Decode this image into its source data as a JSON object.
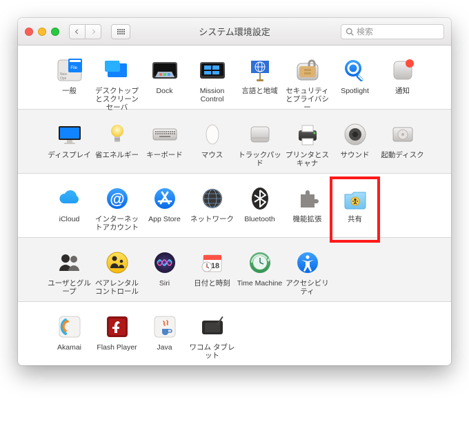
{
  "window": {
    "title": "システム環境設定"
  },
  "search": {
    "placeholder": "検索"
  },
  "highlight": "sharing",
  "sections": [
    {
      "alt": false,
      "items": [
        {
          "id": "general",
          "label": "一般"
        },
        {
          "id": "desktop",
          "label": "デスクトップとスクリーンセーバ"
        },
        {
          "id": "dock",
          "label": "Dock"
        },
        {
          "id": "mission",
          "label": "Mission Control"
        },
        {
          "id": "language",
          "label": "言語と地域"
        },
        {
          "id": "security",
          "label": "セキュリティとプライバシー"
        },
        {
          "id": "spotlight",
          "label": "Spotlight"
        },
        {
          "id": "notifications",
          "label": "通知"
        }
      ]
    },
    {
      "alt": true,
      "items": [
        {
          "id": "displays",
          "label": "ディスプレイ"
        },
        {
          "id": "energy",
          "label": "省エネルギー"
        },
        {
          "id": "keyboard",
          "label": "キーボード"
        },
        {
          "id": "mouse",
          "label": "マウス"
        },
        {
          "id": "trackpad",
          "label": "トラックパッド"
        },
        {
          "id": "printers",
          "label": "プリンタとスキャナ"
        },
        {
          "id": "sound",
          "label": "サウンド"
        },
        {
          "id": "startup",
          "label": "起動ディスク"
        }
      ]
    },
    {
      "alt": false,
      "items": [
        {
          "id": "icloud",
          "label": "iCloud"
        },
        {
          "id": "internet",
          "label": "インターネットアカウント"
        },
        {
          "id": "appstore",
          "label": "App Store"
        },
        {
          "id": "network",
          "label": "ネットワーク"
        },
        {
          "id": "bluetooth",
          "label": "Bluetooth"
        },
        {
          "id": "extensions",
          "label": "機能拡張"
        },
        {
          "id": "sharing",
          "label": "共有"
        }
      ]
    },
    {
      "alt": true,
      "items": [
        {
          "id": "users",
          "label": "ユーザとグループ"
        },
        {
          "id": "parental",
          "label": "ペアレンタルコントロール"
        },
        {
          "id": "siri",
          "label": "Siri"
        },
        {
          "id": "datetime",
          "label": "日付と時刻"
        },
        {
          "id": "timemachine",
          "label": "Time Machine"
        },
        {
          "id": "accessibility",
          "label": "アクセシビリティ"
        }
      ]
    },
    {
      "alt": false,
      "items": [
        {
          "id": "akamai",
          "label": "Akamai"
        },
        {
          "id": "flash",
          "label": "Flash Player"
        },
        {
          "id": "java",
          "label": "Java"
        },
        {
          "id": "wacom",
          "label": "ワコム タブレット"
        }
      ]
    }
  ]
}
